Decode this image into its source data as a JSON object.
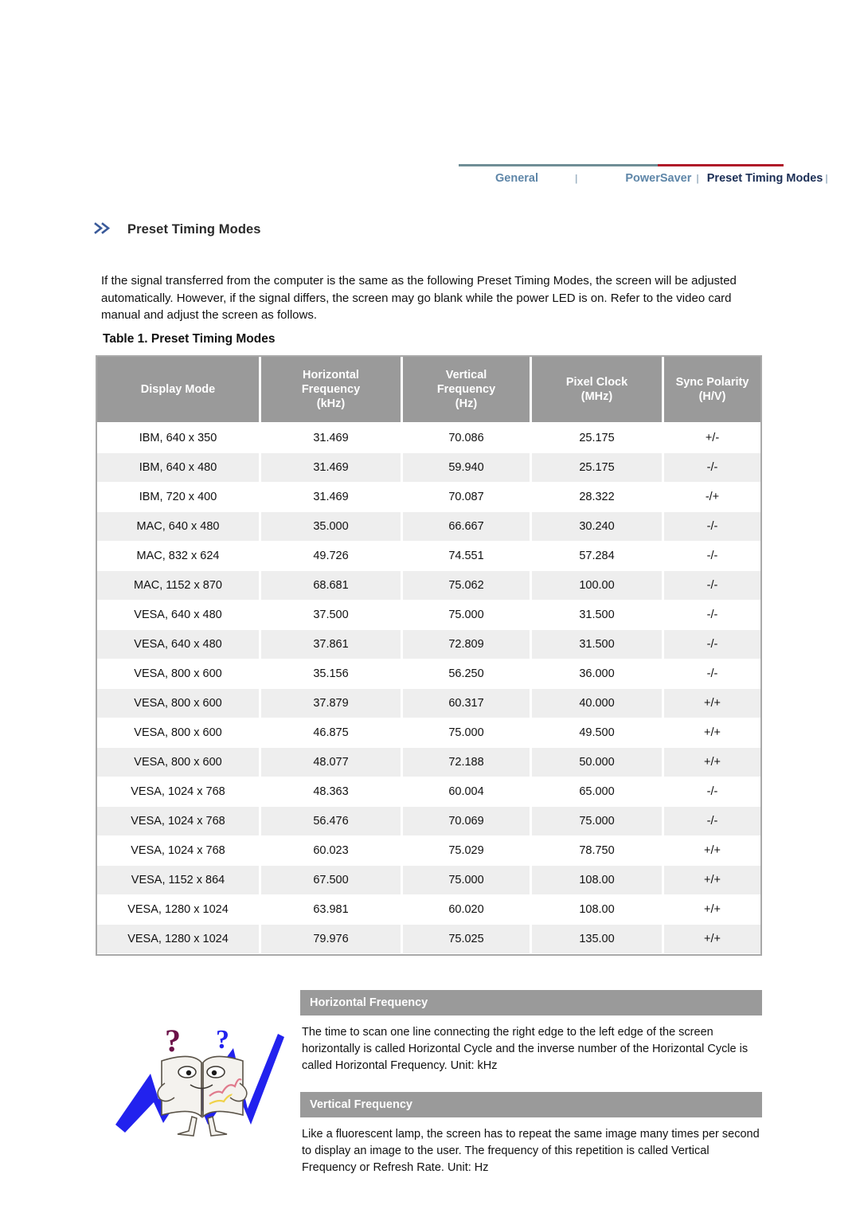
{
  "nav": {
    "tabs": [
      {
        "label": "General",
        "active": false
      },
      {
        "label": "PowerSaver",
        "active": false
      },
      {
        "label": "Preset Timing Modes",
        "active": true
      }
    ],
    "separator": "|",
    "rule_color_left": "#6f8e96",
    "rule_color_right": "#b01929",
    "tab_color": "#5e86a8",
    "active_tab_color": "#1b2e55"
  },
  "section": {
    "title": "Preset Timing Modes",
    "intro": "If the signal transferred from the computer is the same as the following Preset Timing Modes, the screen will be adjusted automatically. However, if the signal differs, the screen may go blank while the power LED is on. Refer to the video card manual and adjust the screen as follows."
  },
  "table": {
    "caption": "Table 1. Preset Timing Modes",
    "header_bg": "#9a9a9a",
    "alt_row_bg": "#eeeeee",
    "columns": [
      "Display Mode",
      "Horizontal\nFrequency\n(kHz)",
      "Vertical\nFrequency\n(Hz)",
      "Pixel Clock\n(MHz)",
      "Sync Polarity\n(H/V)"
    ],
    "columns_lines": [
      [
        "Display Mode"
      ],
      [
        "Horizontal",
        "Frequency",
        "(kHz)"
      ],
      [
        "Vertical",
        "Frequency",
        "(Hz)"
      ],
      [
        "Pixel Clock",
        "(MHz)"
      ],
      [
        "Sync Polarity",
        "(H/V)"
      ]
    ],
    "rows": [
      [
        "IBM, 640 x 350",
        "31.469",
        "70.086",
        "25.175",
        "+/-"
      ],
      [
        "IBM, 640 x 480",
        "31.469",
        "59.940",
        "25.175",
        "-/-"
      ],
      [
        "IBM, 720 x 400",
        "31.469",
        "70.087",
        "28.322",
        "-/+"
      ],
      [
        "MAC, 640 x 480",
        "35.000",
        "66.667",
        "30.240",
        "-/-"
      ],
      [
        "MAC, 832 x 624",
        "49.726",
        "74.551",
        "57.284",
        "-/-"
      ],
      [
        "MAC, 1152 x 870",
        "68.681",
        "75.062",
        "100.00",
        "-/-"
      ],
      [
        "VESA, 640 x 480",
        "37.500",
        "75.000",
        "31.500",
        "-/-"
      ],
      [
        "VESA, 640 x 480",
        "37.861",
        "72.809",
        "31.500",
        "-/-"
      ],
      [
        "VESA, 800 x 600",
        "35.156",
        "56.250",
        "36.000",
        "-/-"
      ],
      [
        "VESA, 800 x 600",
        "37.879",
        "60.317",
        "40.000",
        "+/+"
      ],
      [
        "VESA, 800 x 600",
        "46.875",
        "75.000",
        "49.500",
        "+/+"
      ],
      [
        "VESA, 800 x 600",
        "48.077",
        "72.188",
        "50.000",
        "+/+"
      ],
      [
        "VESA, 1024 x 768",
        "48.363",
        "60.004",
        "65.000",
        "-/-"
      ],
      [
        "VESA, 1024 x 768",
        "56.476",
        "70.069",
        "75.000",
        "-/-"
      ],
      [
        "VESA, 1024 x 768",
        "60.023",
        "75.029",
        "78.750",
        "+/+"
      ],
      [
        "VESA, 1152 x 864",
        "67.500",
        "75.000",
        "108.00",
        "+/+"
      ],
      [
        "VESA, 1280 x 1024",
        "63.981",
        "60.020",
        "108.00",
        "+/+"
      ],
      [
        "VESA, 1280 x 1024",
        "79.976",
        "75.025",
        "135.00",
        "+/+"
      ]
    ]
  },
  "definitions": [
    {
      "title": "Horizontal Frequency",
      "body": "The time to scan one line connecting the right edge to the left edge of the screen horizontally is called Horizontal Cycle and the inverse number of the Horizontal Cycle is called Horizontal Frequency. Unit: kHz"
    },
    {
      "title": "Vertical Frequency",
      "body": "Like a fluorescent lamp, the screen has to repeat the same image many times per second to display an image to the user. The frequency of this repetition is called Vertical Frequency or Refresh Rate. Unit: Hz"
    }
  ],
  "mascot": {
    "name": "open-book-character-illustration",
    "zigzag_color": "#2222ee",
    "book_color": "#f4f2ee",
    "question_mark_left_color": "#6b1048",
    "question_mark_right_color": "#2222ee"
  }
}
